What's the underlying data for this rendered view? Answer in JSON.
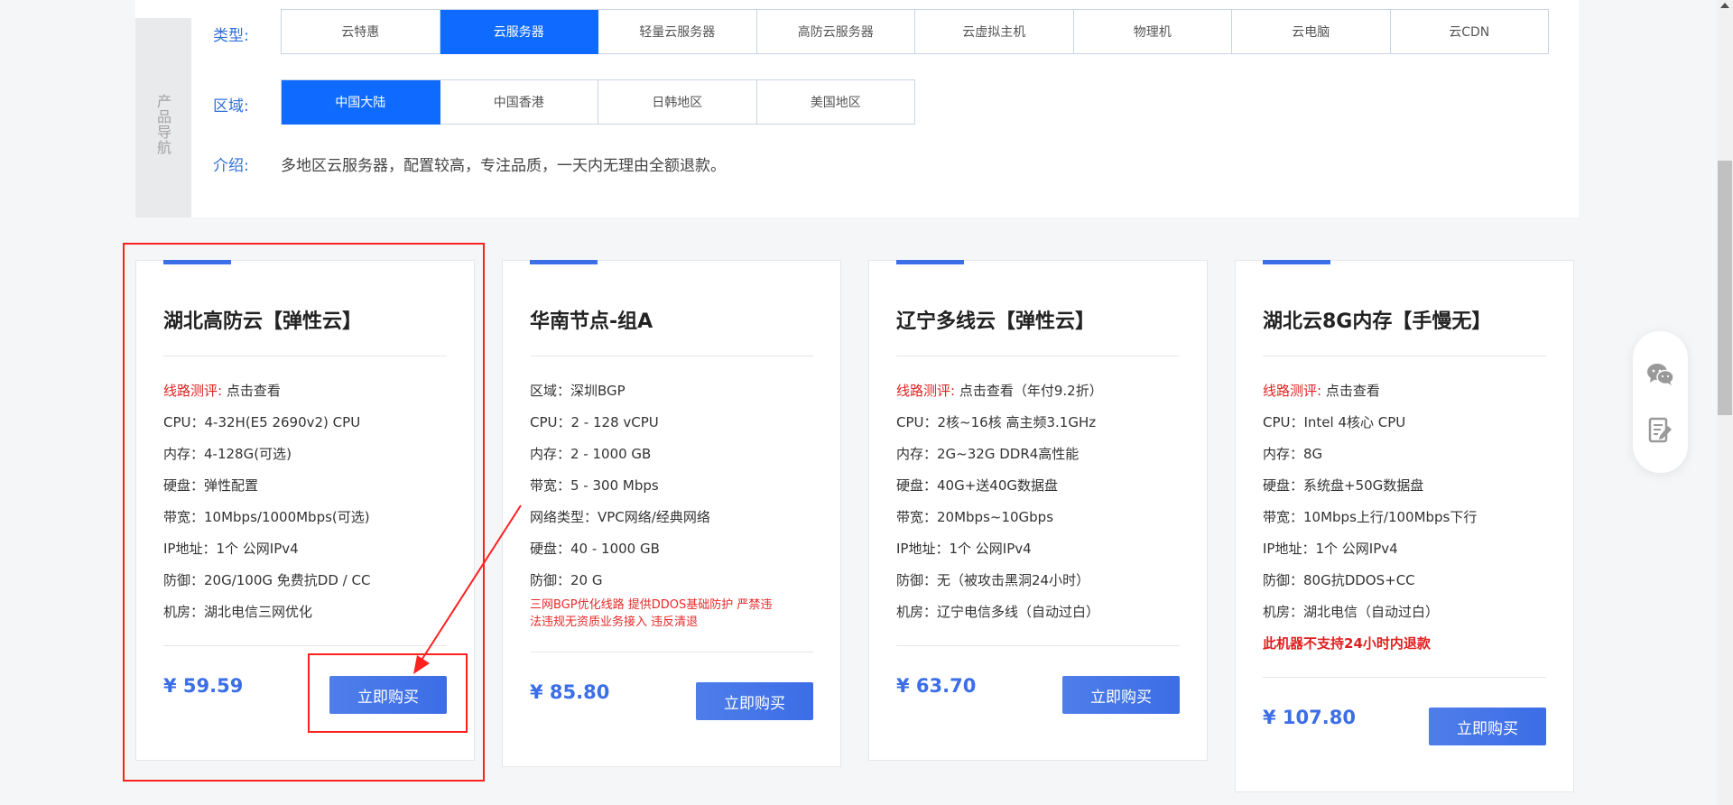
{
  "nav": {
    "side_label": [
      "产",
      "品",
      "导",
      "航"
    ],
    "type_label": "类型:",
    "types": [
      {
        "label": "云特惠",
        "active": false
      },
      {
        "label": "云服务器",
        "active": true
      },
      {
        "label": "轻量云服务器",
        "active": false
      },
      {
        "label": "高防云服务器",
        "active": false
      },
      {
        "label": "云虚拟主机",
        "active": false
      },
      {
        "label": "物理机",
        "active": false
      },
      {
        "label": "云电脑",
        "active": false
      },
      {
        "label": "云CDN",
        "active": false
      }
    ],
    "region_label": "区域:",
    "regions": [
      {
        "label": "中国大陆",
        "active": true
      },
      {
        "label": "中国香港",
        "active": false
      },
      {
        "label": "日韩地区",
        "active": false
      },
      {
        "label": "美国地区",
        "active": false
      }
    ],
    "intro_label": "介绍:",
    "intro_text": "多地区云服务器，配置较高，专注品质，一天内无理由全额退款。"
  },
  "cards": [
    {
      "title": "湖北高防云【弹性云】",
      "review_label": "线路测评:",
      "review_value": "点击查看",
      "specs": [
        "CPU：4-32H(E5 2690v2) CPU",
        "内存：4-128G(可选)",
        "硬盘：弹性配置",
        "带宽：10Mbps/1000Mbps(可选)",
        "IP地址：1个 公网IPv4",
        "防御：20G/100G 免费抗DD / CC",
        "机房：湖北电信三网优化"
      ],
      "price": "¥ 59.59",
      "buy_label": "立即购买"
    },
    {
      "title": "华南节点-组A",
      "specs": [
        "区域：深圳BGP",
        "CPU：2 - 128 vCPU",
        "内存：2 - 1000 GB",
        "带宽：5 - 300 Mbps",
        "网络类型：VPC网络/经典网络",
        "硬盘：40 - 1000 GB",
        "防御：20 G"
      ],
      "note_lines": [
        "三网BGP优化线路 提供DDOS基础防护 严禁违",
        "法违规无资质业务接入 违反清退"
      ],
      "price": "¥ 85.80",
      "buy_label": "立即购买"
    },
    {
      "title": "辽宁多线云【弹性云】",
      "review_label": "线路测评:",
      "review_value": "点击查看（年付9.2折）",
      "specs": [
        "CPU：2核~16核 高主频3.1GHz",
        "内存：2G~32G DDR4高性能",
        "硬盘：40G+送40G数据盘",
        "带宽：20Mbps~10Gbps",
        "IP地址：1个 公网IPv4",
        "防御：无（被攻击黑洞24小时）",
        "机房：辽宁电信多线（自动过白）"
      ],
      "price": "¥ 63.70",
      "buy_label": "立即购买"
    },
    {
      "title": "湖北云8G内存【手慢无】",
      "review_label": "线路测评:",
      "review_value": "点击查看",
      "specs": [
        "CPU：Intel 4核心 CPU",
        "内存：8G",
        "硬盘：系统盘+50G数据盘",
        "带宽：10Mbps上行/100Mbps下行",
        "IP地址：1个 公网IPv4",
        "防御：80G抗DDOS+CC",
        "机房：湖北电信（自动过白）"
      ],
      "warning": "此机器不支持24小时内退款",
      "price": "¥ 107.80",
      "buy_label": "立即购买"
    }
  ],
  "colors": {
    "accent_blue": "#0f6bff",
    "price_blue": "#3b6ee7",
    "label_blue": "#2f6fd8",
    "warning_red": "#e02323",
    "annotation_red": "#ff2020"
  },
  "float_bar": {
    "icons": [
      "wechat-icon",
      "edit-document-icon"
    ]
  }
}
